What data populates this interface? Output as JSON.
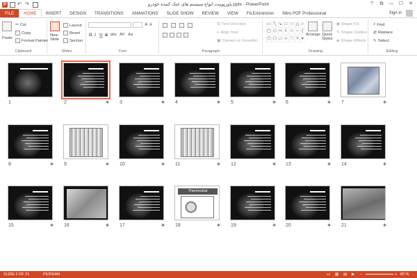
{
  "window": {
    "title": "پاورپوینت انواع سیستم های خنک کننده خودرو.pptx - PowerPoint",
    "app_badge": "P",
    "controls": [
      "?",
      "⧉",
      "—",
      "☐",
      "✕"
    ]
  },
  "tabs": [
    {
      "label": "FILE"
    },
    {
      "label": "HOME"
    },
    {
      "label": "INSERT"
    },
    {
      "label": "DESIGN"
    },
    {
      "label": "TRANSITIONS"
    },
    {
      "label": "ANIMATIONS"
    },
    {
      "label": "SLIDE SHOW"
    },
    {
      "label": "REVIEW"
    },
    {
      "label": "VIEW"
    },
    {
      "label": "FILEminimizer"
    },
    {
      "label": "Nitro PDF Professional"
    }
  ],
  "signin": "Sign in",
  "ribbon": {
    "clipboard": {
      "label": "Clipboard",
      "paste": "Paste",
      "cut": "Cut",
      "copy": "Copy",
      "format_painter": "Format Painter"
    },
    "slides": {
      "label": "Slides",
      "new_slide": "New",
      "new_slide2": "Slide",
      "layout": "Layout",
      "reset": "Reset",
      "section": "Section"
    },
    "font": {
      "label": "Font",
      "bold": "B",
      "italic": "I",
      "underline": "U",
      "strike": "S",
      "shadow": "abc",
      "spacing": "AV",
      "case": "Aa",
      "size_up": "A",
      "size_down": "A"
    },
    "paragraph": {
      "label": "Paragraph",
      "text_direction": "Text Direction",
      "align_text": "Align Text",
      "smartart": "Convert to SmartArt"
    },
    "drawing": {
      "label": "Drawing",
      "arrange": "Arrange",
      "quick_styles": "Quick",
      "quick_styles2": "Styles",
      "shape_fill": "Shape Fill",
      "shape_outline": "Shape Outline",
      "shape_effects": "Shape Effects"
    },
    "editing": {
      "label": "Editing",
      "find": "Find",
      "replace": "Replace",
      "select": "Select"
    }
  },
  "slides": [
    {
      "num": "1",
      "kind": "dark-title"
    },
    {
      "num": "2",
      "kind": "dark-text",
      "selected": true
    },
    {
      "num": "3",
      "kind": "dark-text"
    },
    {
      "num": "4",
      "kind": "dark-text"
    },
    {
      "num": "5",
      "kind": "dark-text"
    },
    {
      "num": "6",
      "kind": "dark-text"
    },
    {
      "num": "7",
      "kind": "engine"
    },
    {
      "num": "8",
      "kind": "dark-text"
    },
    {
      "num": "9",
      "kind": "diagram"
    },
    {
      "num": "10",
      "kind": "dark-text"
    },
    {
      "num": "11",
      "kind": "diagram"
    },
    {
      "num": "12",
      "kind": "dark-text"
    },
    {
      "num": "13",
      "kind": "dark-text"
    },
    {
      "num": "14",
      "kind": "dark-text"
    },
    {
      "num": "15",
      "kind": "dark-text"
    },
    {
      "num": "16",
      "kind": "photo"
    },
    {
      "num": "17",
      "kind": "dark-text"
    },
    {
      "num": "18",
      "kind": "thermostat",
      "heading": "Thermostat"
    },
    {
      "num": "19",
      "kind": "dark-text"
    },
    {
      "num": "20",
      "kind": "dark-text"
    },
    {
      "num": "21",
      "kind": "laptop"
    }
  ],
  "status": {
    "slide_indicator": "SLIDE 2 OF 21",
    "language": "PERSIAN",
    "zoom": "60 %"
  }
}
